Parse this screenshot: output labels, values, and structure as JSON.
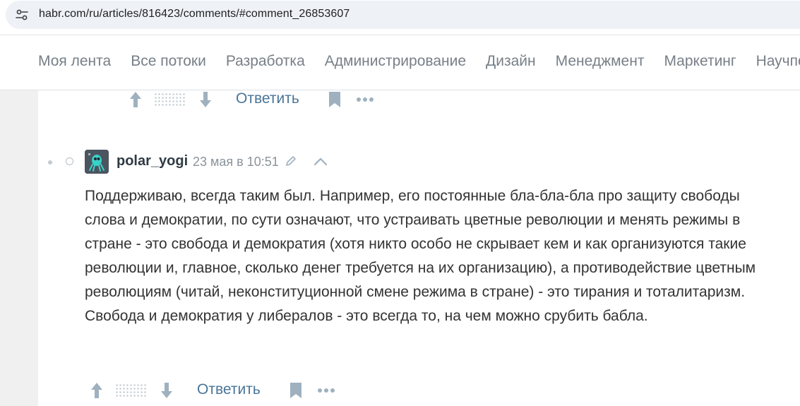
{
  "browser": {
    "url": "habr.com/ru/articles/816423/comments/#comment_26853607",
    "site_info_icon": "tune-icon"
  },
  "nav": {
    "items": [
      "Моя лента",
      "Все потоки",
      "Разработка",
      "Администрирование",
      "Дизайн",
      "Менеджмент",
      "Маркетинг",
      "Научпоп"
    ]
  },
  "prev_actions": {
    "reply_label": "Ответить",
    "icons": [
      "arrow-up-icon",
      "arrow-down-icon",
      "bookmark-icon",
      "more-icon"
    ]
  },
  "comment": {
    "author": "polar_yogi",
    "datetime": "23 мая в 10:51",
    "body": "Поддерживаю, всегда таким был. Например, его постоянные бла-бла-бла про защиту свободы слова и демократии, по сути означают, что устраивать цветные революции и менять режимы в стране - это свобода и демократия (хотя никто особо не скрывает кем и как организуются такие революции и, главное, сколько денег требуется на их организацию), а противодействие цветным революциям (читай, неконституционной смене режима в стране) - это тирания и тоталитаризм. Свобода и демократия у либералов - это всегда то, на чем можно срубить бабла.",
    "icons": [
      "avatar",
      "edit-icon",
      "chevron-up-icon"
    ]
  },
  "comment_actions": {
    "reply_label": "Ответить"
  },
  "colors": {
    "link": "#4a7598",
    "icon": "#9fb1bf",
    "nav_text": "#777f87",
    "body_text": "#333333"
  }
}
